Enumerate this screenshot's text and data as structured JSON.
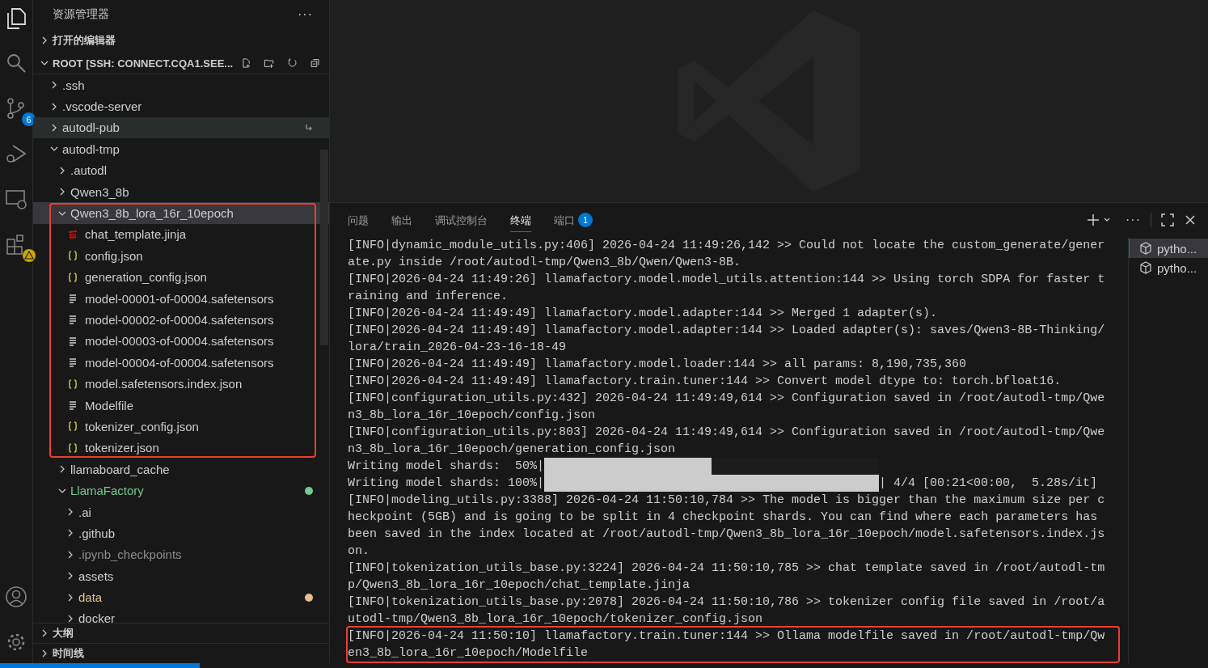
{
  "activity_bar": {
    "source_control_badge": "6"
  },
  "sidebar": {
    "title": "资源管理器",
    "more": "···",
    "open_editors": {
      "label": "打开的编辑器",
      "expanded": false
    },
    "root": {
      "label": "ROOT [SSH: CONNECT.CQA1.SEE...",
      "expanded": true
    },
    "tree": [
      {
        "label": ".ssh",
        "kind": "folder",
        "expanded": false,
        "selected": false
      },
      {
        "label": ".vscode-server",
        "kind": "folder",
        "expanded": false,
        "selected": false
      },
      {
        "label": "autodl-pub",
        "kind": "folder",
        "expanded": false,
        "selected": false,
        "hovered": true,
        "symlink": true
      },
      {
        "label": "autodl-tmp",
        "kind": "folder",
        "expanded": true,
        "selected": false,
        "children": [
          {
            "label": ".autodl",
            "kind": "folder",
            "expanded": false,
            "selected": false
          },
          {
            "label": "Qwen3_8b",
            "kind": "folder",
            "expanded": false,
            "selected": false
          },
          {
            "label": "Qwen3_8b_lora_16r_10epoch",
            "kind": "folder",
            "expanded": true,
            "selected": true,
            "annotated": true,
            "children": [
              {
                "label": "chat_template.jinja",
                "kind": "template",
                "selected": false
              },
              {
                "label": "config.json",
                "kind": "json",
                "selected": false
              },
              {
                "label": "generation_config.json",
                "kind": "json",
                "selected": false
              },
              {
                "label": "model-00001-of-00004.safetensors",
                "kind": "text",
                "selected": false
              },
              {
                "label": "model-00002-of-00004.safetensors",
                "kind": "text",
                "selected": false
              },
              {
                "label": "model-00003-of-00004.safetensors",
                "kind": "text",
                "selected": false
              },
              {
                "label": "model-00004-of-00004.safetensors",
                "kind": "text",
                "selected": false
              },
              {
                "label": "model.safetensors.index.json",
                "kind": "json",
                "selected": false
              },
              {
                "label": "Modelfile",
                "kind": "text",
                "selected": false
              },
              {
                "label": "tokenizer_config.json",
                "kind": "json",
                "selected": false
              },
              {
                "label": "tokenizer.json",
                "kind": "json",
                "selected": false
              }
            ]
          },
          {
            "label": "llamaboard_cache",
            "kind": "folder",
            "expanded": false,
            "selected": false
          },
          {
            "label": "LlamaFactory",
            "kind": "folder",
            "expanded": true,
            "selected": false,
            "color": "#73c991",
            "children": [
              {
                "label": ".ai",
                "kind": "folder",
                "expanded": false,
                "selected": false
              },
              {
                "label": ".github",
                "kind": "folder",
                "expanded": false,
                "selected": false
              },
              {
                "label": ".ipynb_checkpoints",
                "kind": "folder",
                "expanded": false,
                "selected": false,
                "ignored": true
              },
              {
                "label": "assets",
                "kind": "folder",
                "expanded": false,
                "selected": false
              },
              {
                "label": "data",
                "kind": "folder",
                "expanded": false,
                "selected": false,
                "color": "#e2c08d"
              },
              {
                "label": "docker",
                "kind": "folder",
                "expanded": false,
                "selected": false
              }
            ]
          }
        ]
      }
    ],
    "sections": [
      {
        "label": "大纲",
        "expanded": false
      },
      {
        "label": "时间线",
        "expanded": false
      }
    ]
  },
  "panel": {
    "tabs": [
      {
        "label": "问题",
        "selected": false
      },
      {
        "label": "输出",
        "selected": false
      },
      {
        "label": "调试控制台",
        "selected": false
      },
      {
        "label": "终端",
        "selected": true
      },
      {
        "label": "端口",
        "selected": false,
        "badge": "1"
      }
    ],
    "more": "···",
    "terminals": [
      {
        "label": "pytho...",
        "selected": true
      },
      {
        "label": "pytho...",
        "selected": false
      }
    ],
    "terminal": [
      {
        "annotated": false,
        "lines": [
          {
            "kind": "text",
            "text": "[INFO|dynamic_module_utils.py:406] 2026-04-24 11:49:26,142 >> Could not locate the custom_generate/gener"
          },
          {
            "kind": "text",
            "text": "ate.py inside /root/autodl-tmp/Qwen3_8b/Qwen/Qwen3-8B."
          },
          {
            "kind": "text",
            "text": "[INFO|2026-04-24 11:49:26] llamafactory.model.model_utils.attention:144 >> Using torch SDPA for faster t"
          },
          {
            "kind": "text",
            "text": "raining and inference."
          },
          {
            "kind": "text",
            "text": "[INFO|2026-04-24 11:49:49] llamafactory.model.adapter:144 >> Merged 1 adapter(s)."
          },
          {
            "kind": "text",
            "text": "[INFO|2026-04-24 11:49:49] llamafactory.model.adapter:144 >> Loaded adapter(s): saves/Qwen3-8B-Thinking/"
          },
          {
            "kind": "text",
            "text": "lora/train_2026-04-23-16-18-49"
          },
          {
            "kind": "text",
            "text": "[INFO|2026-04-24 11:49:49] llamafactory.model.loader:144 >> all params: 8,190,735,360"
          },
          {
            "kind": "text",
            "text": "[INFO|2026-04-24 11:49:49] llamafactory.train.tuner:144 >> Convert model dtype to: torch.bfloat16."
          },
          {
            "kind": "text",
            "text": "[INFO|configuration_utils.py:432] 2026-04-24 11:49:49,614 >> Configuration saved in /root/autodl-tmp/Qwe"
          },
          {
            "kind": "text",
            "text": "n3_8b_lora_16r_10epoch/config.json"
          },
          {
            "kind": "text",
            "text": "[INFO|configuration_utils.py:803] 2026-04-24 11:49:49,614 >> Configuration saved in /root/autodl-tmp/Qwe"
          },
          {
            "kind": "text",
            "text": "n3_8b_lora_16r_10epoch/generation_config.json"
          },
          {
            "kind": "progress",
            "prefix": "Writing model shards:  50%|",
            "level": 0.5
          },
          {
            "kind": "progress",
            "prefix": "Writing model shards: 100%|",
            "level": 1,
            "suffix": "| 4/4 [00:21<00:00,  5.28s/it]"
          },
          {
            "kind": "text",
            "text": "[INFO|modeling_utils.py:3388] 2026-04-24 11:50:10,784 >> The model is bigger than the maximum size per c"
          },
          {
            "kind": "text",
            "text": "heckpoint (5GB) and is going to be split in 4 checkpoint shards. You can find where each parameters has"
          },
          {
            "kind": "text",
            "text": "been saved in the index located at /root/autodl-tmp/Qwen3_8b_lora_16r_10epoch/model.safetensors.index.js"
          },
          {
            "kind": "text",
            "text": "on."
          },
          {
            "kind": "text",
            "text": "[INFO|tokenization_utils_base.py:3224] 2026-04-24 11:50:10,785 >> chat template saved in /root/autodl-tm"
          },
          {
            "kind": "text",
            "text": "p/Qwen3_8b_lora_16r_10epoch/chat_template.jinja"
          },
          {
            "kind": "text",
            "text": "[INFO|tokenization_utils_base.py:2078] 2026-04-24 11:50:10,786 >> tokenizer config file saved in /root/a"
          },
          {
            "kind": "text",
            "text": "utodl-tmp/Qwen3_8b_lora_16r_10epoch/tokenizer_config.json"
          }
        ]
      },
      {
        "annotated": true,
        "lines": [
          {
            "kind": "text",
            "text": "[INFO|2026-04-24 11:50:10] llamafactory.train.tuner:144 >> Ollama modelfile saved in /root/autodl-tmp/Qw"
          },
          {
            "kind": "text",
            "text": "en3_8b_lora_16r_10epoch/Modelfile"
          }
        ]
      }
    ]
  }
}
